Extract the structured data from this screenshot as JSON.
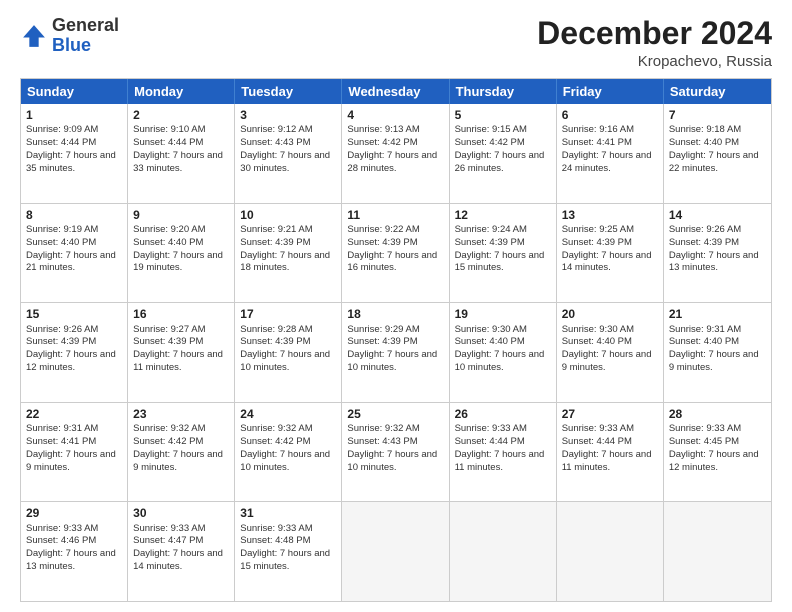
{
  "logo": {
    "general": "General",
    "blue": "Blue"
  },
  "header": {
    "month": "December 2024",
    "location": "Kropachevo, Russia"
  },
  "days": [
    "Sunday",
    "Monday",
    "Tuesday",
    "Wednesday",
    "Thursday",
    "Friday",
    "Saturday"
  ],
  "rows": [
    [
      {
        "day": "1",
        "sunrise": "9:09 AM",
        "sunset": "4:44 PM",
        "daylight": "7 hours and 35 minutes."
      },
      {
        "day": "2",
        "sunrise": "9:10 AM",
        "sunset": "4:44 PM",
        "daylight": "7 hours and 33 minutes."
      },
      {
        "day": "3",
        "sunrise": "9:12 AM",
        "sunset": "4:43 PM",
        "daylight": "7 hours and 30 minutes."
      },
      {
        "day": "4",
        "sunrise": "9:13 AM",
        "sunset": "4:42 PM",
        "daylight": "7 hours and 28 minutes."
      },
      {
        "day": "5",
        "sunrise": "9:15 AM",
        "sunset": "4:42 PM",
        "daylight": "7 hours and 26 minutes."
      },
      {
        "day": "6",
        "sunrise": "9:16 AM",
        "sunset": "4:41 PM",
        "daylight": "7 hours and 24 minutes."
      },
      {
        "day": "7",
        "sunrise": "9:18 AM",
        "sunset": "4:40 PM",
        "daylight": "7 hours and 22 minutes."
      }
    ],
    [
      {
        "day": "8",
        "sunrise": "9:19 AM",
        "sunset": "4:40 PM",
        "daylight": "7 hours and 21 minutes."
      },
      {
        "day": "9",
        "sunrise": "9:20 AM",
        "sunset": "4:40 PM",
        "daylight": "7 hours and 19 minutes."
      },
      {
        "day": "10",
        "sunrise": "9:21 AM",
        "sunset": "4:39 PM",
        "daylight": "7 hours and 18 minutes."
      },
      {
        "day": "11",
        "sunrise": "9:22 AM",
        "sunset": "4:39 PM",
        "daylight": "7 hours and 16 minutes."
      },
      {
        "day": "12",
        "sunrise": "9:24 AM",
        "sunset": "4:39 PM",
        "daylight": "7 hours and 15 minutes."
      },
      {
        "day": "13",
        "sunrise": "9:25 AM",
        "sunset": "4:39 PM",
        "daylight": "7 hours and 14 minutes."
      },
      {
        "day": "14",
        "sunrise": "9:26 AM",
        "sunset": "4:39 PM",
        "daylight": "7 hours and 13 minutes."
      }
    ],
    [
      {
        "day": "15",
        "sunrise": "9:26 AM",
        "sunset": "4:39 PM",
        "daylight": "7 hours and 12 minutes."
      },
      {
        "day": "16",
        "sunrise": "9:27 AM",
        "sunset": "4:39 PM",
        "daylight": "7 hours and 11 minutes."
      },
      {
        "day": "17",
        "sunrise": "9:28 AM",
        "sunset": "4:39 PM",
        "daylight": "7 hours and 10 minutes."
      },
      {
        "day": "18",
        "sunrise": "9:29 AM",
        "sunset": "4:39 PM",
        "daylight": "7 hours and 10 minutes."
      },
      {
        "day": "19",
        "sunrise": "9:30 AM",
        "sunset": "4:40 PM",
        "daylight": "7 hours and 10 minutes."
      },
      {
        "day": "20",
        "sunrise": "9:30 AM",
        "sunset": "4:40 PM",
        "daylight": "7 hours and 9 minutes."
      },
      {
        "day": "21",
        "sunrise": "9:31 AM",
        "sunset": "4:40 PM",
        "daylight": "7 hours and 9 minutes."
      }
    ],
    [
      {
        "day": "22",
        "sunrise": "9:31 AM",
        "sunset": "4:41 PM",
        "daylight": "7 hours and 9 minutes."
      },
      {
        "day": "23",
        "sunrise": "9:32 AM",
        "sunset": "4:42 PM",
        "daylight": "7 hours and 9 minutes."
      },
      {
        "day": "24",
        "sunrise": "9:32 AM",
        "sunset": "4:42 PM",
        "daylight": "7 hours and 10 minutes."
      },
      {
        "day": "25",
        "sunrise": "9:32 AM",
        "sunset": "4:43 PM",
        "daylight": "7 hours and 10 minutes."
      },
      {
        "day": "26",
        "sunrise": "9:33 AM",
        "sunset": "4:44 PM",
        "daylight": "7 hours and 11 minutes."
      },
      {
        "day": "27",
        "sunrise": "9:33 AM",
        "sunset": "4:44 PM",
        "daylight": "7 hours and 11 minutes."
      },
      {
        "day": "28",
        "sunrise": "9:33 AM",
        "sunset": "4:45 PM",
        "daylight": "7 hours and 12 minutes."
      }
    ],
    [
      {
        "day": "29",
        "sunrise": "9:33 AM",
        "sunset": "4:46 PM",
        "daylight": "7 hours and 13 minutes."
      },
      {
        "day": "30",
        "sunrise": "9:33 AM",
        "sunset": "4:47 PM",
        "daylight": "7 hours and 14 minutes."
      },
      {
        "day": "31",
        "sunrise": "9:33 AM",
        "sunset": "4:48 PM",
        "daylight": "7 hours and 15 minutes."
      },
      null,
      null,
      null,
      null
    ]
  ]
}
